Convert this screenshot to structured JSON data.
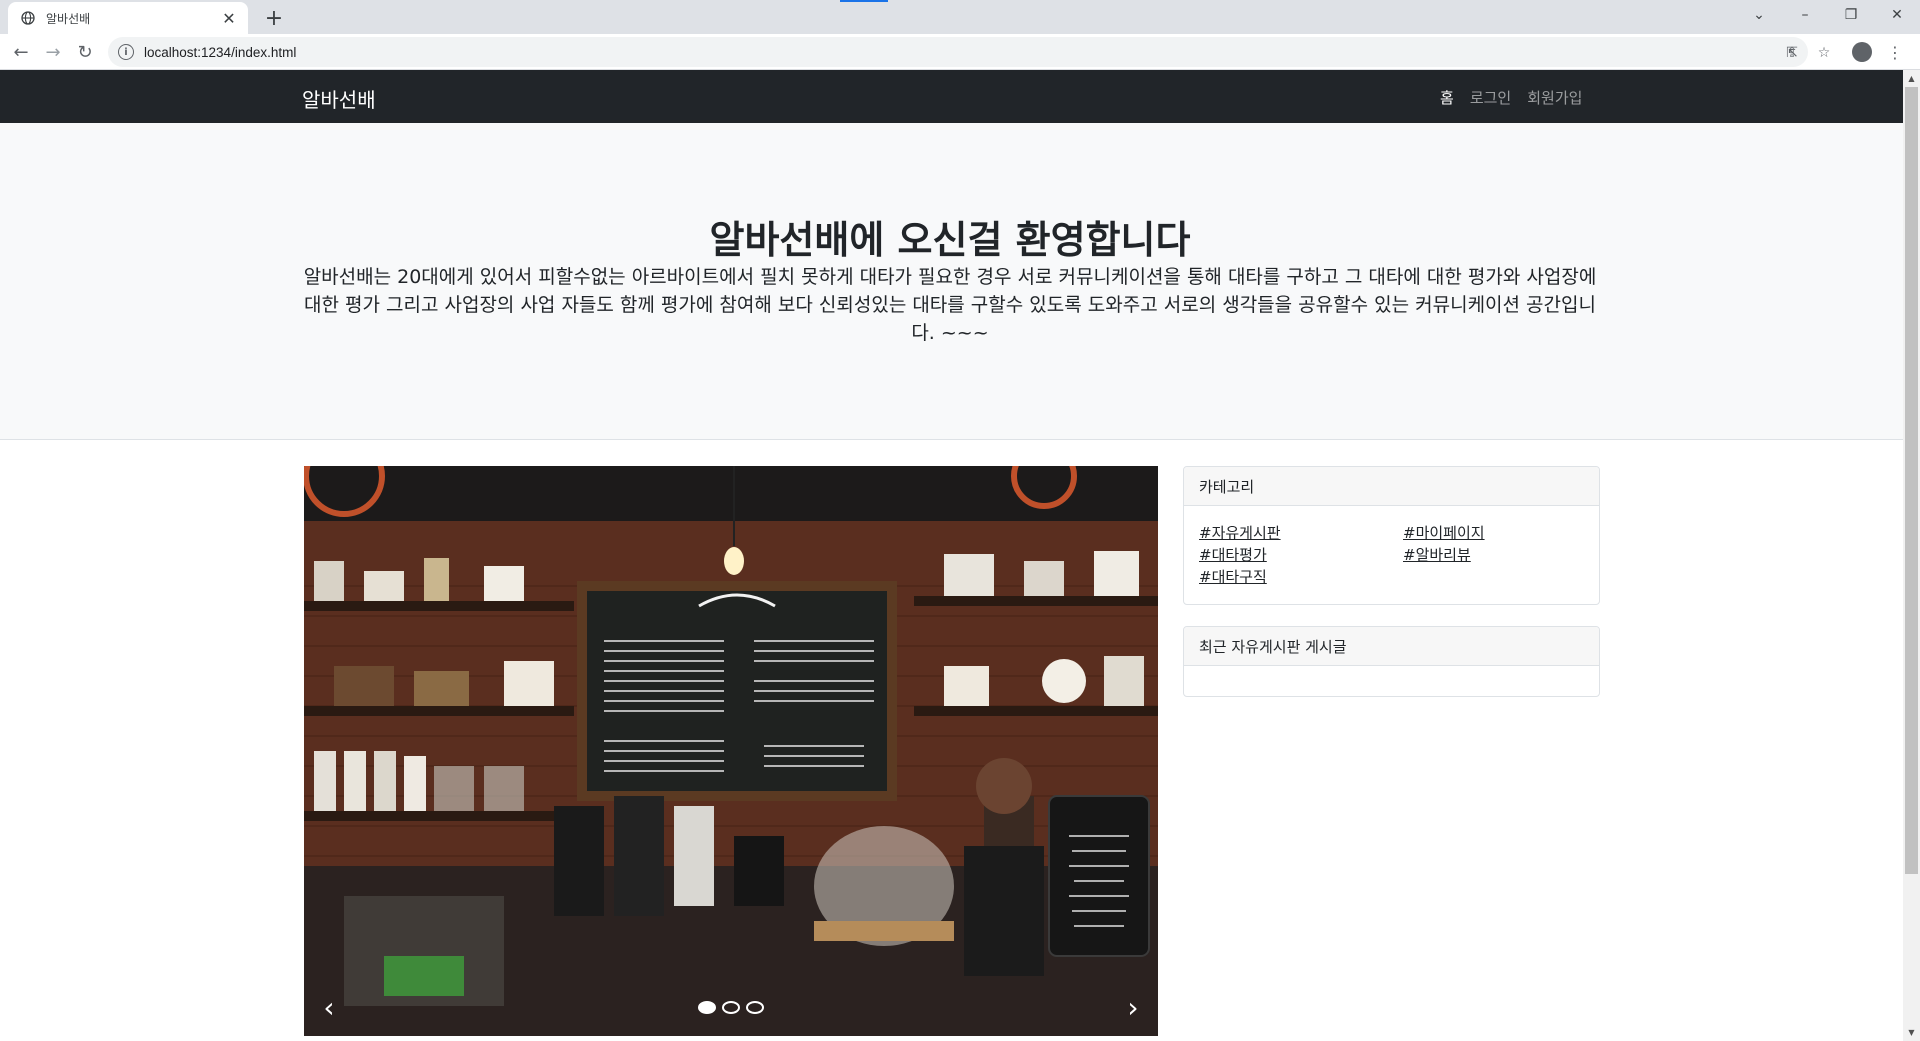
{
  "browser": {
    "tab_title": "알바선배",
    "url": "localhost:1234/index.html"
  },
  "navbar": {
    "brand": "알바선배",
    "links": [
      {
        "label": "홈",
        "active": true
      },
      {
        "label": "로그인",
        "active": false
      },
      {
        "label": "회원가입",
        "active": false
      }
    ]
  },
  "hero": {
    "title": "알바선배에 오신걸 환영합니다",
    "text": "알바선배는 20대에게 있어서 피할수없는 아르바이트에서 필치 못하게 대타가 필요한 경우 서로 커뮤니케이션을 통해 대타를 구하고 그 대타에 대한 평가와 사업장에 대한 평가 그리고 사업장의 사업 자들도 함께 평가에 참여해 보다 신뢰성있는 대타를 구할수 있도록 도와주고 서로의 생각들을 공유할수 있는 커뮤니케이션 공간입니다. ~~~"
  },
  "carousel": {
    "prev_label": "‹",
    "next_label": "›",
    "slide_count": 3,
    "active_index": 0
  },
  "category_card": {
    "header": "카테고리",
    "links": [
      "#자유게시판",
      "#마이페이지",
      "#대타평가",
      "#알바리뷰",
      "#대타구직"
    ]
  },
  "recent_card": {
    "header": "최근 자유게시판 게시글"
  },
  "colors": {
    "navbar_bg": "#212529",
    "hero_bg": "#f8f9fa",
    "accent": "#1a73e8"
  }
}
